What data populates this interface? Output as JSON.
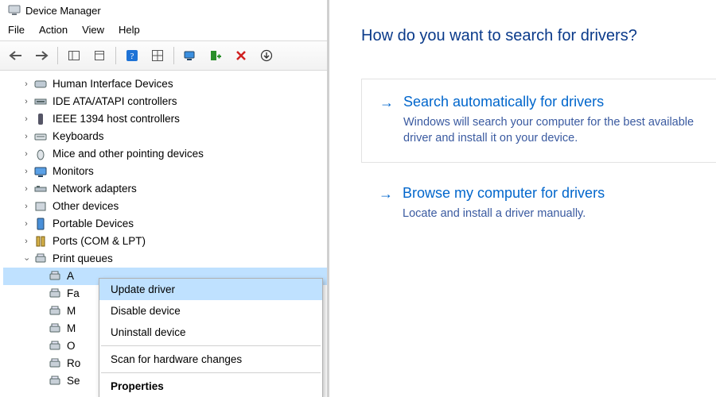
{
  "window": {
    "title": "Device Manager"
  },
  "menu": {
    "items": [
      "File",
      "Action",
      "View",
      "Help"
    ]
  },
  "tree": {
    "nodes": [
      {
        "label": "Human Interface Devices",
        "expanded": false
      },
      {
        "label": "IDE ATA/ATAPI controllers",
        "expanded": false
      },
      {
        "label": "IEEE 1394 host controllers",
        "expanded": false
      },
      {
        "label": "Keyboards",
        "expanded": false
      },
      {
        "label": "Mice and other pointing devices",
        "expanded": false
      },
      {
        "label": "Monitors",
        "expanded": false
      },
      {
        "label": "Network adapters",
        "expanded": false
      },
      {
        "label": "Other devices",
        "expanded": false
      },
      {
        "label": "Portable Devices",
        "expanded": false
      },
      {
        "label": "Ports (COM & LPT)",
        "expanded": false
      },
      {
        "label": "Print queues",
        "expanded": true
      }
    ],
    "children": [
      {
        "label": "A",
        "selected": true
      },
      {
        "label": "Fa"
      },
      {
        "label": "M"
      },
      {
        "label": "M"
      },
      {
        "label": "O"
      },
      {
        "label": "Ro"
      },
      {
        "label": "Se"
      }
    ]
  },
  "context_menu": {
    "items": [
      {
        "label": "Update driver",
        "selected": true
      },
      {
        "label": "Disable device"
      },
      {
        "label": "Uninstall device"
      },
      {
        "sep": true
      },
      {
        "label": "Scan for hardware changes"
      },
      {
        "sep": true
      },
      {
        "label": "Properties",
        "bold": true
      }
    ]
  },
  "wizard": {
    "heading": "How do you want to search for drivers?",
    "option1": {
      "title": "Search automatically for drivers",
      "desc": "Windows will search your computer for the best available driver and install it on your device."
    },
    "option2": {
      "title": "Browse my computer for drivers",
      "desc": "Locate and install a driver manually."
    }
  }
}
